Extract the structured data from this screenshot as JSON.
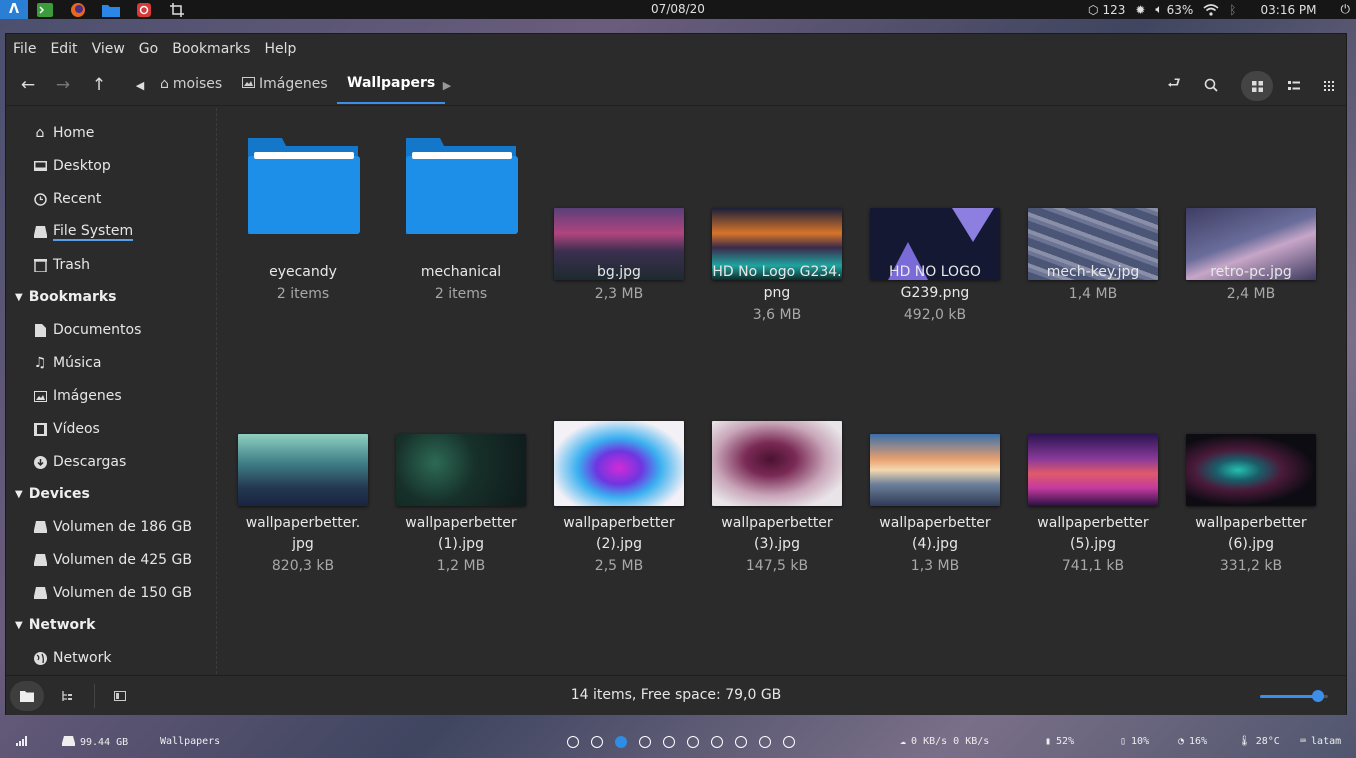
{
  "topbar": {
    "date": "07/08/20",
    "updates": "123",
    "volume": "63%",
    "time": "03:16 PM"
  },
  "menu": [
    "File",
    "Edit",
    "View",
    "Go",
    "Bookmarks",
    "Help"
  ],
  "breadcrumb": {
    "home": "moises",
    "pictures": "Imágenes",
    "current": "Wallpapers"
  },
  "sidebar": {
    "places": [
      "Home",
      "Desktop",
      "Recent",
      "File System",
      "Trash"
    ],
    "bookmarks_header": "Bookmarks",
    "bookmarks": [
      "Documentos",
      "Música",
      "Imágenes",
      "Vídeos",
      "Descargas"
    ],
    "devices_header": "Devices",
    "devices": [
      "Volumen de 186 GB",
      "Volumen de 425 GB",
      "Volumen de 150 GB"
    ],
    "network_header": "Network",
    "network": [
      "Network"
    ]
  },
  "files": [
    {
      "name": "eyecandy",
      "size": "2 items"
    },
    {
      "name": "mechanical",
      "size": "2 items"
    },
    {
      "name": "bg.jpg",
      "size": "2,3 MB"
    },
    {
      "name": "HD No Logo G234.\npng",
      "size": "3,6 MB"
    },
    {
      "name": "HD NO LOGO\nG239.png",
      "size": "492,0 kB"
    },
    {
      "name": "mech-key.jpg",
      "size": "1,4 MB"
    },
    {
      "name": "retro-pc.jpg",
      "size": "2,4 MB"
    },
    {
      "name": "wallpaperbetter.\njpg",
      "size": "820,3 kB"
    },
    {
      "name": "wallpaperbetter\n(1).jpg",
      "size": "1,2 MB"
    },
    {
      "name": "wallpaperbetter\n(2).jpg",
      "size": "2,5 MB"
    },
    {
      "name": "wallpaperbetter\n(3).jpg",
      "size": "147,5 kB"
    },
    {
      "name": "wallpaperbetter\n(4).jpg",
      "size": "1,3 MB"
    },
    {
      "name": "wallpaperbetter\n(5).jpg",
      "size": "741,1 kB"
    },
    {
      "name": "wallpaperbetter\n(6).jpg",
      "size": "331,2 kB"
    }
  ],
  "status": {
    "text": "14 items, Free space: 79,0 GB",
    "zoom": 0.85
  },
  "dock": {
    "disk": "99.44 GB",
    "window": "Wallpapers",
    "net": "0 KB/s 0 KB/s",
    "battery": "52%",
    "mem": "10%",
    "cpu": "16%",
    "temp": "28°C",
    "layout": "latam"
  },
  "colors": {
    "accent": "#3d8ee8",
    "folder": "#1e8fe8",
    "background": "#2b2b2b"
  }
}
